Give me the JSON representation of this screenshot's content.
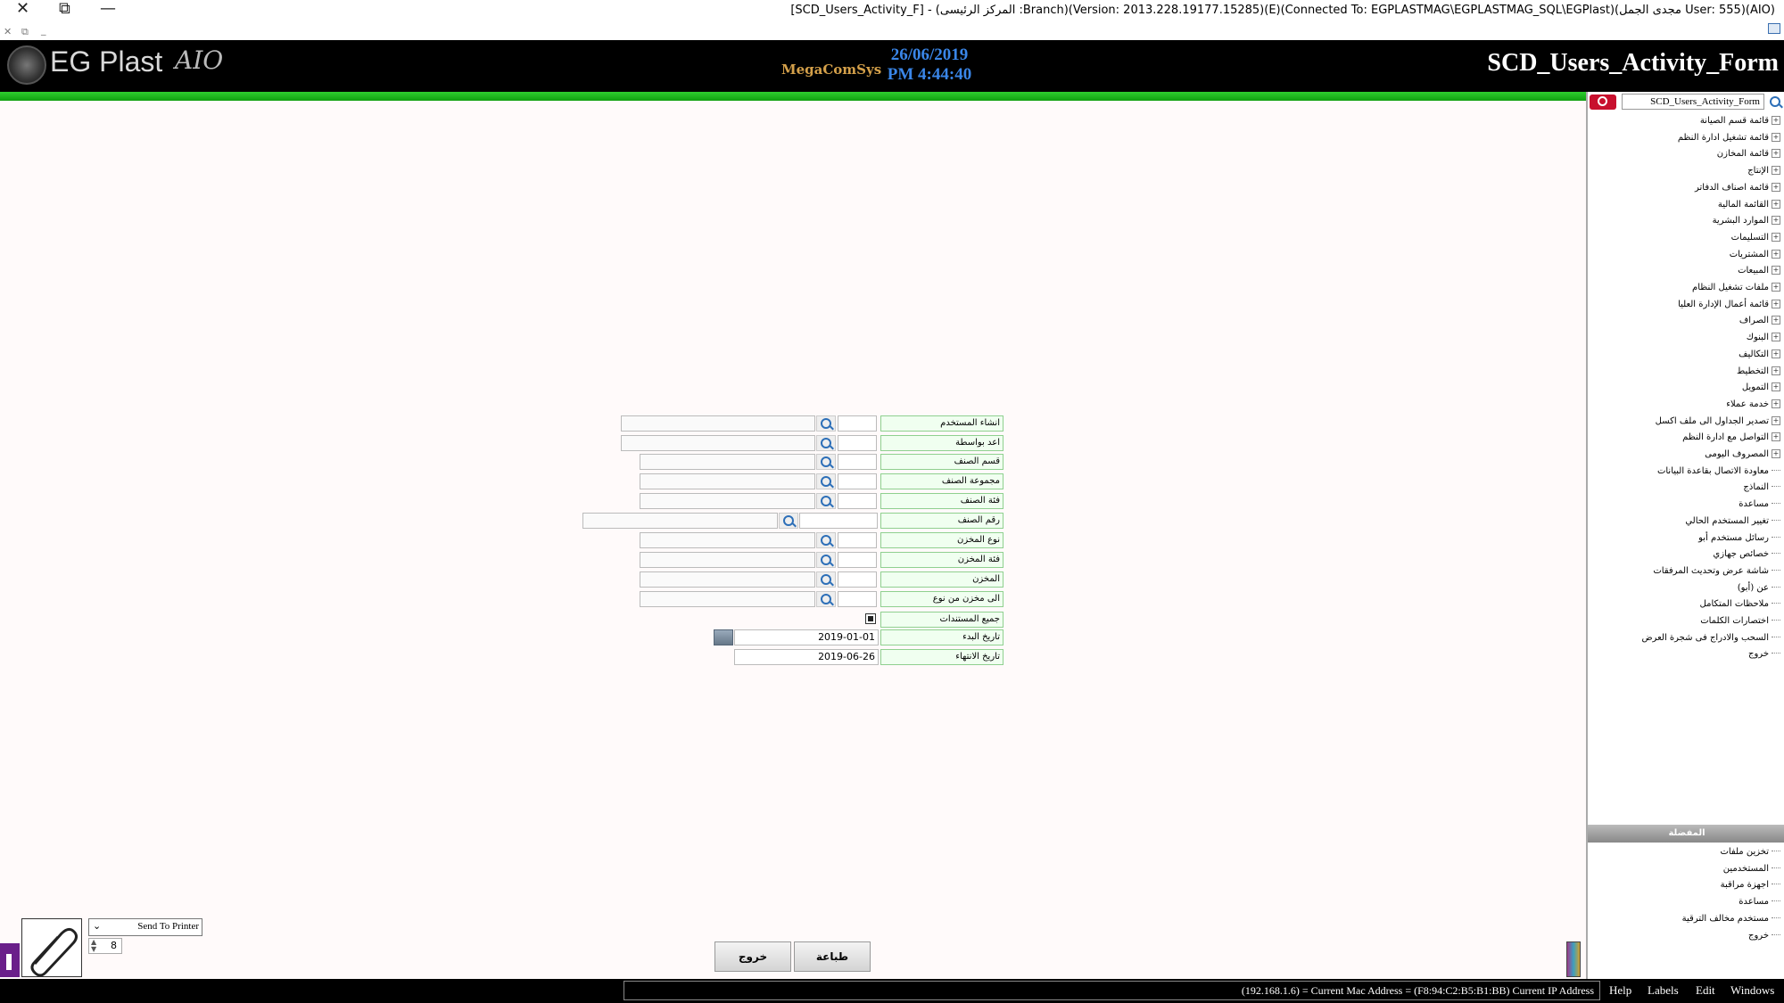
{
  "window": {
    "title": "[SCD_Users_Activity_F] - (المركز الرئيسى :Branch)(Version: 2013.228.19177.15285)(E)(Connected To: EGPLASTMAG\\EGPLASTMAG_SQL\\EGPlast)(مجدى الجمل User: 555)(AIO)",
    "close_glyph": "✕",
    "restore_glyph": "⧉",
    "minimize_glyph": "—",
    "mini_close": "✕",
    "mini_restore": "⧉",
    "mini_min": "_"
  },
  "header": {
    "logo_text": "EG Plast",
    "logo_suffix": "AIO",
    "brand_small": "MegaComSys",
    "date": "26/06/2019",
    "time": "PM 4:44:40",
    "form_title": "SCD_Users_Activity_Form"
  },
  "right_panel": {
    "search_value": "SCD_Users_Activity_Form",
    "tree_items": [
      {
        "label": "قائمة قسم الصيانة",
        "expandable": true
      },
      {
        "label": "قائمة تشغيل ادارة النظم",
        "expandable": true
      },
      {
        "label": "قائمة المخازن",
        "expandable": true
      },
      {
        "label": "الإنتاج",
        "expandable": true
      },
      {
        "label": "قائمة اصناف الدفاتر",
        "expandable": true
      },
      {
        "label": "القائمة المالية",
        "expandable": true
      },
      {
        "label": "الموارد البشرية",
        "expandable": true
      },
      {
        "label": "التسليمات",
        "expandable": true
      },
      {
        "label": "المشتريات",
        "expandable": true
      },
      {
        "label": "المبيعات",
        "expandable": true
      },
      {
        "label": "ملفات تشغيل النظام",
        "expandable": true
      },
      {
        "label": "قائمة أعمال الإدارة العليا",
        "expandable": true
      },
      {
        "label": "الصراف",
        "expandable": true
      },
      {
        "label": "البنوك",
        "expandable": true
      },
      {
        "label": "التكاليف",
        "expandable": true
      },
      {
        "label": "التخطيط",
        "expandable": true
      },
      {
        "label": "التمويل",
        "expandable": true
      },
      {
        "label": "خدمة عملاء",
        "expandable": true
      },
      {
        "label": "تصدير الجداول الى ملف اكسل",
        "expandable": true
      },
      {
        "label": "التواصل مع ادارة النظم",
        "expandable": true
      },
      {
        "label": "المصروف اليومى",
        "expandable": true
      },
      {
        "label": "معاودة الاتصال بقاعدة البيانات",
        "expandable": false
      },
      {
        "label": "النماذج",
        "expandable": false
      },
      {
        "label": "مساعدة",
        "expandable": false
      },
      {
        "label": "تغيير المستخدم الحالي",
        "expandable": false
      },
      {
        "label": "رسائل مستخدم أبو",
        "expandable": false
      },
      {
        "label": "خصائص جهازي",
        "expandable": false
      },
      {
        "label": "شاشة عرض وتحديث المرفقات",
        "expandable": false
      },
      {
        "label": "عن (أبو)",
        "expandable": false
      },
      {
        "label": "ملاحظات المتكامل",
        "expandable": false
      },
      {
        "label": "اختصارات الكلمات",
        "expandable": false
      },
      {
        "label": "السحب والادراج فى شجرة العرض",
        "expandable": false
      },
      {
        "label": "خروج",
        "expandable": false
      }
    ],
    "favorites_header": "المفضلة",
    "favorites": [
      {
        "label": "تخزين ملفات"
      },
      {
        "label": "المستخدمين"
      },
      {
        "label": "اجهزة مراقبة"
      },
      {
        "label": "مساعدة"
      },
      {
        "label": "مستخدم مخالف الترقية"
      },
      {
        "label": "خروج"
      }
    ]
  },
  "form": {
    "fields": [
      {
        "label": "انشاء المستخدم"
      },
      {
        "label": "اعد بواسطة"
      },
      {
        "label": "قسم الصنف"
      },
      {
        "label": "مجموعة الصنف"
      },
      {
        "label": "فئة الصنف"
      },
      {
        "label": "رقم الصنف"
      },
      {
        "label": "نوع المخزن"
      },
      {
        "label": "فئة المخزن"
      },
      {
        "label": "المخزن"
      },
      {
        "label": "الى مخزن من نوع"
      }
    ],
    "all_docs_label": "جميع المستندات",
    "start_date_label": "تاريخ البدء",
    "start_date": "2019-01-01",
    "end_date_label": "تاريخ الانتهاء",
    "end_date": "2019-06-26",
    "print_button": "طباعة",
    "exit_button": "خروج"
  },
  "bottom_left": {
    "send_to": "Send To Printer",
    "copies": "8"
  },
  "statusbar": {
    "text": "(192.168.1.6) = Current Mac Address = (F8:94:C2:B5:B1:BB) Current IP Address",
    "menu": [
      "Help",
      "Labels",
      "Edit",
      "Windows"
    ]
  }
}
